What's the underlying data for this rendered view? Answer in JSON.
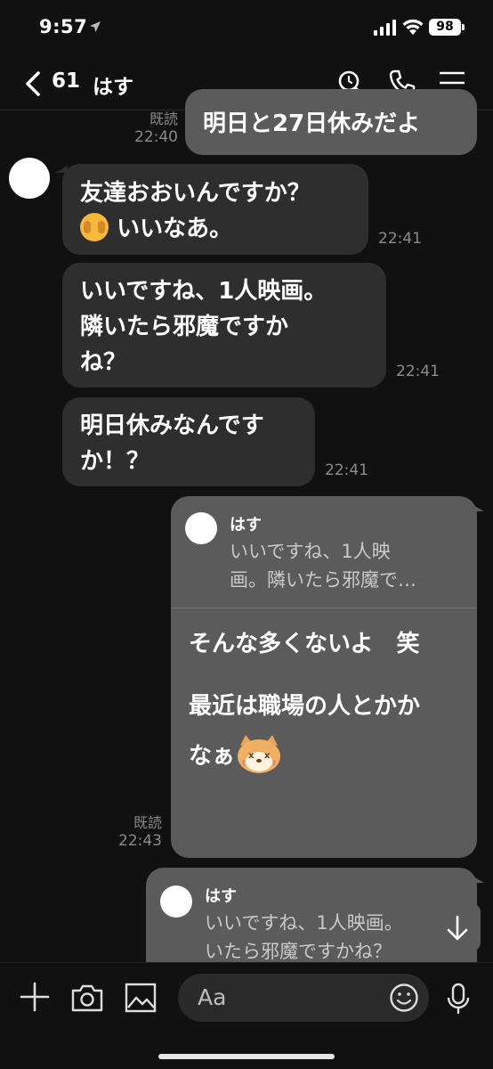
{
  "status_bar": {
    "time": "9:57",
    "battery": "98"
  },
  "header": {
    "back_count": "61",
    "chat_name": "はす"
  },
  "messages": [
    {
      "direction": "out",
      "read": "既読",
      "time": "22:40",
      "text": "明日と27日休みだよ"
    },
    {
      "direction": "in",
      "line1": "友達おおいんですか？",
      "line2": "いいなあ。",
      "time": "22:41"
    },
    {
      "direction": "in",
      "line1": "いいですね、1人映画。",
      "line2": "隣いたら邪魔ですか",
      "line3": "ね？",
      "time": "22:41"
    },
    {
      "direction": "in",
      "line1": "明日休みなんです",
      "line2": "か！？",
      "time": "22:41"
    },
    {
      "direction": "out",
      "read": "既読",
      "time": "22:43",
      "quote_name": "はす",
      "quote_line1": "いいですね、1人映",
      "quote_line2": "画。隣いたら邪魔で…",
      "line1": "そんな多くないよ　笑",
      "line2": "最近は職場の人とかか",
      "line3": "なぁ"
    },
    {
      "direction": "out",
      "quote_name": "はす",
      "quote_line1": "いいですね、1人映画。",
      "quote_line2": "いたら邪魔ですかね？"
    }
  ],
  "input": {
    "placeholder": "Aa"
  },
  "icons": [
    "location-arrow-icon",
    "signal-icon",
    "wifi-icon",
    "back-chevron-icon",
    "search-icon",
    "phone-icon",
    "menu-icon",
    "plus-icon",
    "camera-icon",
    "image-icon",
    "smiley-icon",
    "mic-icon",
    "arrow-down-icon"
  ]
}
